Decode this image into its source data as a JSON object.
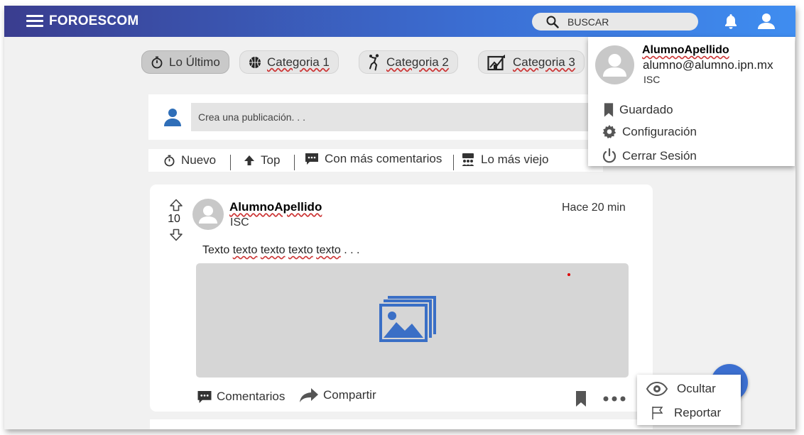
{
  "app": {
    "brand": "FOROESCOM"
  },
  "header": {
    "search_placeholder": "BUSCAR",
    "icons": {
      "menu": "hamburger-menu-icon",
      "search": "search-icon",
      "notifications": "bell-icon",
      "user": "user-icon"
    }
  },
  "categories": [
    {
      "label": "Lo Último",
      "icon": "stopwatch-icon",
      "active": true
    },
    {
      "label": "Categoria 1",
      "icon": "basketball-icon",
      "active": false
    },
    {
      "label": "Categoria 2",
      "icon": "basketball-player-icon",
      "active": false
    },
    {
      "label": "Categoria 3",
      "icon": "chart-board-icon",
      "active": false
    }
  ],
  "compose": {
    "placeholder": "Crea una publicación. . ."
  },
  "sort_options": [
    {
      "label": "Nuevo",
      "icon": "stopwatch-icon"
    },
    {
      "label": "Top",
      "icon": "arrow-up-icon"
    },
    {
      "label": "Con más comentarios",
      "icon": "comment-icon"
    },
    {
      "label": "Lo más viejo",
      "icon": "group-icon"
    }
  ],
  "post": {
    "votes": "10",
    "author": "AlumnoApellido",
    "career": "ISC",
    "time": "Hace 20 min",
    "text_words": [
      "Texto",
      "texto",
      "texto",
      "texto",
      "texto"
    ],
    "text_suffix": " . . .",
    "actions": {
      "comments": "Comentarios",
      "share": "Compartir"
    }
  },
  "context_menu": {
    "hide": "Ocultar",
    "report": "Reportar"
  },
  "user_menu": {
    "name": "AlumnoApellido",
    "email": "alumno@alumno.ipn.mx",
    "career": "ISC",
    "items": {
      "saved": "Guardado",
      "settings": "Configuración",
      "logout": "Cerrar Sesión"
    }
  },
  "colors": {
    "topbar_start": "#3a3d8f",
    "topbar_end": "#3f8df0",
    "accent": "#3c6fd0",
    "image_placeholder": "#d6d6d6"
  }
}
